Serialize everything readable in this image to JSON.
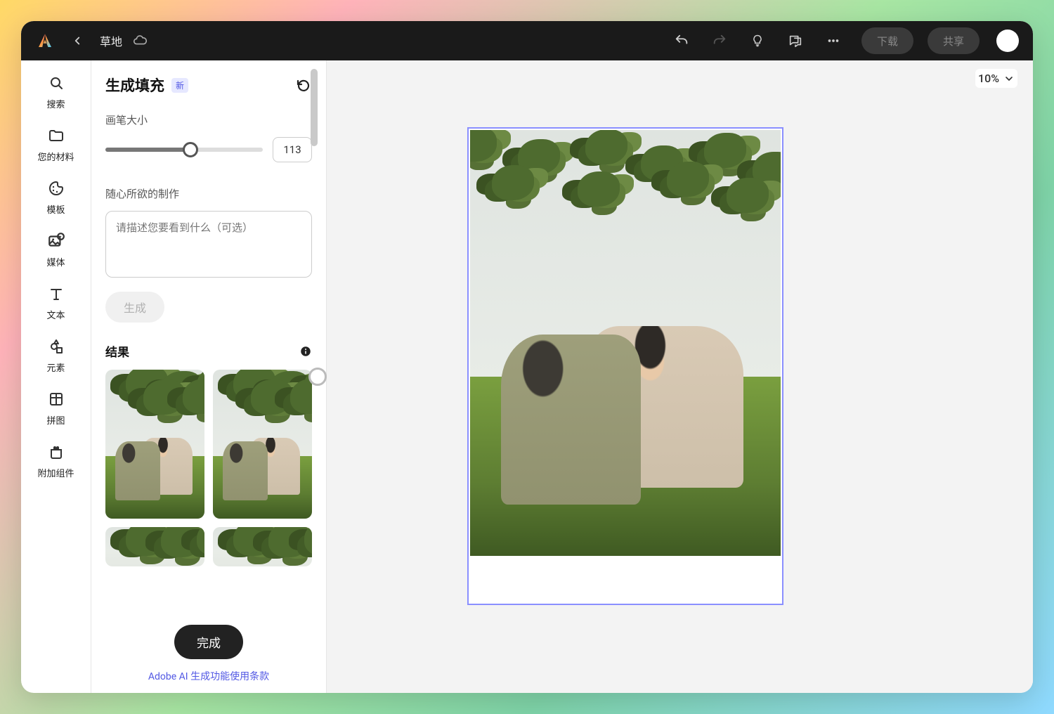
{
  "topbar": {
    "document_title": "草地",
    "download_label": "下载",
    "share_label": "共享"
  },
  "rail": {
    "items": [
      {
        "label": "搜索",
        "icon": "search"
      },
      {
        "label": "您的材料",
        "icon": "folder"
      },
      {
        "label": "模板",
        "icon": "template"
      },
      {
        "label": "媒体",
        "icon": "media"
      },
      {
        "label": "文本",
        "icon": "text"
      },
      {
        "label": "元素",
        "icon": "elements"
      },
      {
        "label": "拼图",
        "icon": "grid"
      },
      {
        "label": "附加组件",
        "icon": "addon"
      }
    ]
  },
  "panel": {
    "title": "生成填充",
    "badge": "新",
    "brush_label": "画笔大小",
    "brush_value": "113",
    "prompt_label": "随心所欲的制作",
    "prompt_placeholder": "请描述您要看到什么（可选）",
    "generate_label": "生成",
    "results_label": "结果",
    "done_label": "完成",
    "terms_label": "Adobe AI 生成功能使用条款"
  },
  "canvas": {
    "zoom_label": "10%"
  }
}
